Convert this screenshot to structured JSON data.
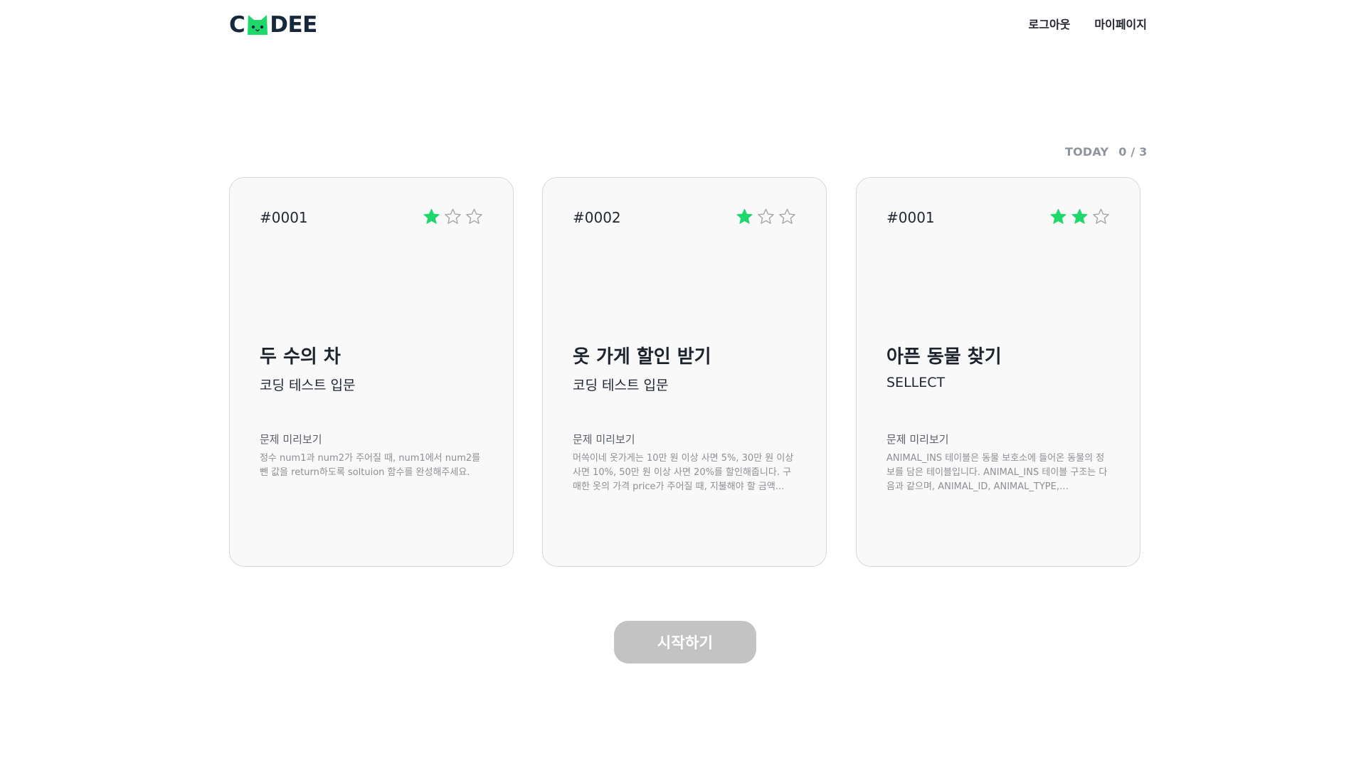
{
  "header": {
    "logo": {
      "left": "C",
      "right": "DEE",
      "icon": "cat-face-logo-icon",
      "brand_color": "#17283b",
      "accent_color": "#1fd86b"
    },
    "nav": {
      "logout": "로그아웃",
      "mypage": "마이페이지"
    }
  },
  "today": {
    "label": "TODAY",
    "count": "0 / 3"
  },
  "cards": [
    {
      "number": "#0001",
      "difficulty": 1,
      "max_difficulty": 3,
      "title": "두 수의 차",
      "subtitle": "코딩 테스트 입문",
      "preview_label": "문제 미리보기",
      "preview_text": "정수 num1과 num2가 주어질 때, num1에서 num2를 뺀 값을 return하도록 soltuion 함수를 완성해주세요."
    },
    {
      "number": "#0002",
      "difficulty": 1,
      "max_difficulty": 3,
      "title": "옷 가게 할인 받기",
      "subtitle": "코딩 테스트 입문",
      "preview_label": "문제 미리보기",
      "preview_text": "머쓱이네 옷가게는 10만 원 이상 사면 5%, 30만 원 이상 사면 10%, 50만 원 이상 사면 20%를 할인해줍니다. 구매한 옷의 가격 price가 주어질 때, 지불해야 할 금액..."
    },
    {
      "number": "#0001",
      "difficulty": 2,
      "max_difficulty": 3,
      "title": "아픈 동물 찾기",
      "subtitle": "SELLECT",
      "preview_label": "문제 미리보기",
      "preview_text": "ANIMAL_INS 테이블은 동물 보호소에 들어온 동물의 정보를 담은 테이블입니다. ANIMAL_INS 테이블 구조는 다음과 같으며, ANIMAL_ID, ANIMAL_TYPE, DATETIM..."
    }
  ],
  "start_button": {
    "label": "시작하기",
    "background": "#c3c3c3"
  }
}
